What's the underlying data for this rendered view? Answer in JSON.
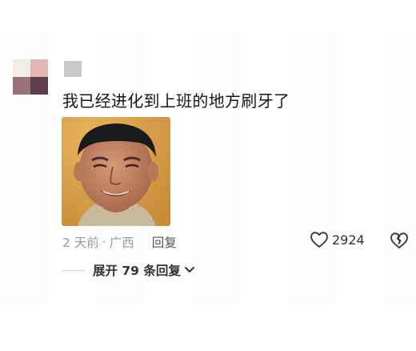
{
  "comment": {
    "text": "我已经进化到上班的地方刷牙了",
    "time": "2 天前",
    "separator": "·",
    "location": "广西",
    "reply_label": "回复",
    "like_count": "2924"
  },
  "replies": {
    "expand_label": "展开 79 条回复"
  },
  "icons": {
    "like": "heart-outline-icon",
    "dislike": "broken-heart-icon",
    "expand": "chevron-down-icon"
  },
  "colors": {
    "text": "#161616",
    "meta": "#9a9a9a",
    "username_placeholder": "#c9c9c9"
  }
}
